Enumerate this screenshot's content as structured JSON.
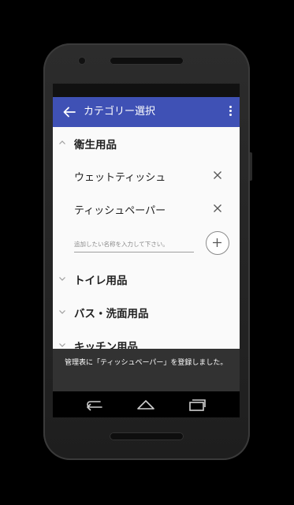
{
  "appbar": {
    "title": "カテゴリー選択",
    "color": "#3f51b5"
  },
  "categories": [
    {
      "label": "衛生用品",
      "expanded": true,
      "items": [
        {
          "label": "ウェットティッシュ"
        },
        {
          "label": "ティッシュペーパー"
        }
      ],
      "add_input": {
        "value": "",
        "placeholder": "追加したい名称を入力して下さい。"
      }
    },
    {
      "label": "トイレ用品",
      "expanded": false
    },
    {
      "label": "バス・洗面用品",
      "expanded": false
    },
    {
      "label": "キッチン用品",
      "expanded": false
    }
  ],
  "snackbar": {
    "message": "管理表に「ティッシュペーパー」を登録しました。"
  },
  "icons": {
    "back": "arrow-back-icon",
    "menu": "more-vert-icon",
    "remove": "close-icon",
    "add": "plus-icon",
    "nav_back": "nav-back-icon",
    "nav_home": "nav-home-icon",
    "nav_recents": "nav-recents-icon"
  }
}
